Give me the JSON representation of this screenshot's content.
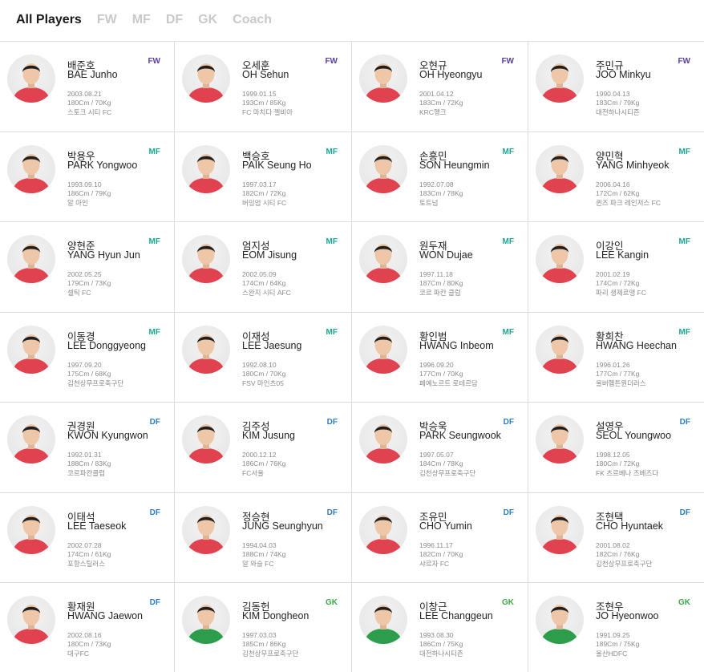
{
  "tabs": [
    {
      "label": "All Players",
      "active": true
    },
    {
      "label": "FW",
      "active": false
    },
    {
      "label": "MF",
      "active": false
    },
    {
      "label": "DF",
      "active": false
    },
    {
      "label": "GK",
      "active": false
    },
    {
      "label": "Coach",
      "active": false
    }
  ],
  "colors": {
    "FW": "#5b3fa0",
    "MF": "#1aa58f",
    "DF": "#2f7fc0",
    "GK": "#3ea84a",
    "kit_outfield": "#e0424f",
    "kit_goalkeeper": "#2c9e4b"
  },
  "players": [
    {
      "korean": "배준호",
      "english": "BAE Junho",
      "position": "FW",
      "birth": "2003.08.21",
      "body": "180Cm / 70Kg",
      "club": "스토크 시티 FC"
    },
    {
      "korean": "오세훈",
      "english": "OH Sehun",
      "position": "FW",
      "birth": "1999.01.15",
      "body": "193Cm / 85Kg",
      "club": "FC 마치다 젤비아"
    },
    {
      "korean": "오현규",
      "english": "OH Hyeongyu",
      "position": "FW",
      "birth": "2001.04.12",
      "body": "183Cm / 72Kg",
      "club": "KRC헹크"
    },
    {
      "korean": "주민규",
      "english": "JOO Minkyu",
      "position": "FW",
      "birth": "1990.04.13",
      "body": "183Cm / 79Kg",
      "club": "대전하나시티즌"
    },
    {
      "korean": "박용우",
      "english": "PARK Yongwoo",
      "position": "MF",
      "birth": "1993.09.10",
      "body": "186Cm / 79Kg",
      "club": "알 아인"
    },
    {
      "korean": "백승호",
      "english": "PAIK Seung Ho",
      "position": "MF",
      "birth": "1997.03.17",
      "body": "182Cm / 72Kg",
      "club": "버밍엄 시티 FC"
    },
    {
      "korean": "손흥민",
      "english": "SON Heungmin",
      "position": "MF",
      "birth": "1992.07.08",
      "body": "183Cm / 78Kg",
      "club": "토트넘"
    },
    {
      "korean": "양민혁",
      "english": "YANG Minhyeok",
      "position": "MF",
      "birth": "2006.04.16",
      "body": "172Cm / 62Kg",
      "club": "퀸즈 파크 레인저스 FC"
    },
    {
      "korean": "양현준",
      "english": "YANG Hyun Jun",
      "position": "MF",
      "birth": "2002.05.25",
      "body": "179Cm / 73Kg",
      "club": "셀틱 FC"
    },
    {
      "korean": "엄지성",
      "english": "EOM Jisung",
      "position": "MF",
      "birth": "2002.05.09",
      "body": "174Cm / 64Kg",
      "club": "스완지 시티 AFC"
    },
    {
      "korean": "원두재",
      "english": "WON Dujae",
      "position": "MF",
      "birth": "1997.11.18",
      "body": "187Cm / 80Kg",
      "club": "코르 파칸 클럽"
    },
    {
      "korean": "이강인",
      "english": "LEE Kangin",
      "position": "MF",
      "birth": "2001.02.19",
      "body": "174Cm / 72Kg",
      "club": "파리 생제르맹 FC"
    },
    {
      "korean": "이동경",
      "english": "LEE Donggyeong",
      "position": "MF",
      "birth": "1997.09.20",
      "body": "175Cm / 68Kg",
      "club": "김천상무프로축구단"
    },
    {
      "korean": "이재성",
      "english": "LEE Jaesung",
      "position": "MF",
      "birth": "1992.08.10",
      "body": "180Cm / 70Kg",
      "club": "FSV 마인츠05"
    },
    {
      "korean": "황인범",
      "english": "HWANG Inbeom",
      "position": "MF",
      "birth": "1996.09.20",
      "body": "177Cm / 70Kg",
      "club": "페예노르트 로테르담"
    },
    {
      "korean": "황희찬",
      "english": "HWANG Heechan",
      "position": "MF",
      "birth": "1996.01.26",
      "body": "177Cm / 77Kg",
      "club": "울버햄튼원더러스"
    },
    {
      "korean": "권경원",
      "english": "KWON Kyungwon",
      "position": "DF",
      "birth": "1992.01.31",
      "body": "188Cm / 83Kg",
      "club": "코르파칸클럽"
    },
    {
      "korean": "김주성",
      "english": "KIM Jusung",
      "position": "DF",
      "birth": "2000.12.12",
      "body": "186Cm / 76Kg",
      "club": "FC서울"
    },
    {
      "korean": "박승욱",
      "english": "PARK Seungwook",
      "position": "DF",
      "birth": "1997.05.07",
      "body": "184Cm / 78Kg",
      "club": "김천상무프로축구단"
    },
    {
      "korean": "설영우",
      "english": "SEOL Youngwoo",
      "position": "DF",
      "birth": "1998.12.05",
      "body": "180Cm / 72Kg",
      "club": "FK 츠르베나 즈베즈다"
    },
    {
      "korean": "이태석",
      "english": "LEE Taeseok",
      "position": "DF",
      "birth": "2002.07.28",
      "body": "174Cm / 61Kg",
      "club": "포항스틸러스"
    },
    {
      "korean": "정승현",
      "english": "JUNG Seunghyun",
      "position": "DF",
      "birth": "1994.04.03",
      "body": "188Cm / 74Kg",
      "club": "알 와슬 FC"
    },
    {
      "korean": "조유민",
      "english": "CHO Yumin",
      "position": "DF",
      "birth": "1996.11.17",
      "body": "182Cm / 70Kg",
      "club": "샤르자 FC"
    },
    {
      "korean": "조현택",
      "english": "CHO Hyuntaek",
      "position": "DF",
      "birth": "2001.08.02",
      "body": "182Cm / 76Kg",
      "club": "김천상무프로축구단"
    },
    {
      "korean": "황재원",
      "english": "HWANG Jaewon",
      "position": "DF",
      "birth": "2002.08.16",
      "body": "180Cm / 73Kg",
      "club": "대구FC"
    },
    {
      "korean": "김동헌",
      "english": "KIM Dongheon",
      "position": "GK",
      "birth": "1997.03.03",
      "body": "185Cm / 86Kg",
      "club": "김천상무프로축구단"
    },
    {
      "korean": "이창근",
      "english": "LEE Changgeun",
      "position": "GK",
      "birth": "1993.08.30",
      "body": "186Cm / 75Kg",
      "club": "대전하나시티즌"
    },
    {
      "korean": "조현우",
      "english": "JO Hyeonwoo",
      "position": "GK",
      "birth": "1991.09.25",
      "body": "189Cm / 75Kg",
      "club": "울산HDFC"
    }
  ]
}
